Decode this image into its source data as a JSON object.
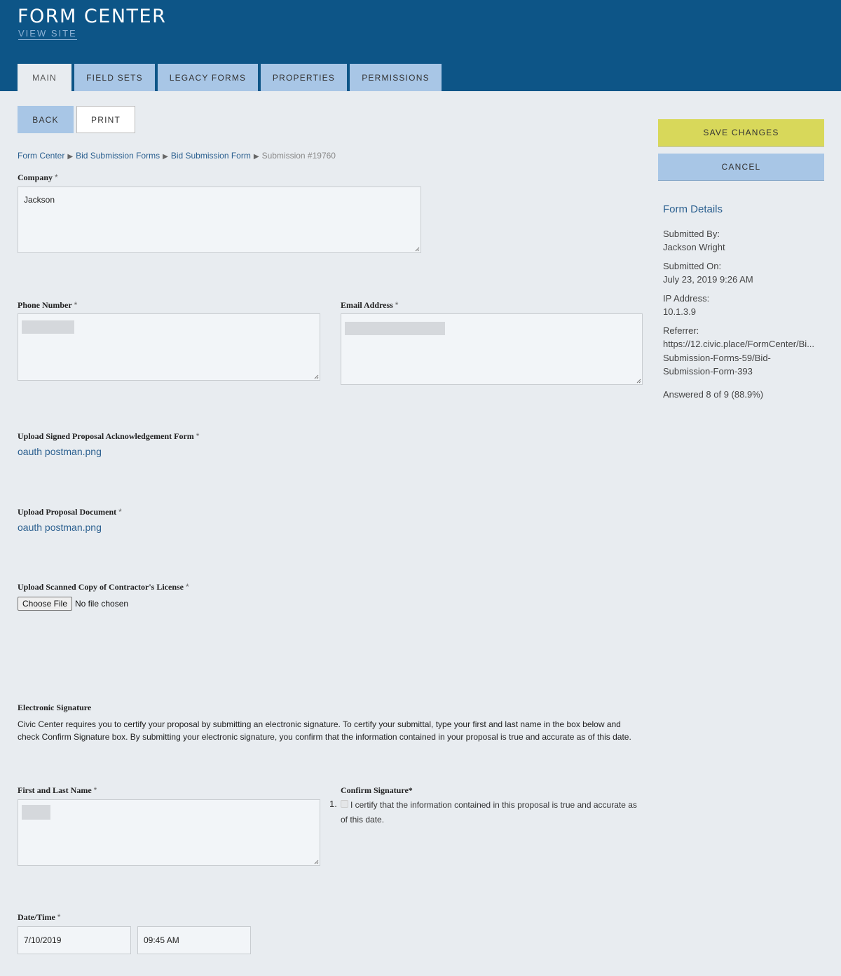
{
  "header": {
    "title": "FORM CENTER",
    "view_site": "VIEW SITE"
  },
  "tabs": [
    {
      "label": "MAIN"
    },
    {
      "label": "FIELD SETS"
    },
    {
      "label": "LEGACY FORMS"
    },
    {
      "label": "PROPERTIES"
    },
    {
      "label": "PERMISSIONS"
    }
  ],
  "toolbar": {
    "back": "BACK",
    "print": "PRINT",
    "save": "SAVE CHANGES",
    "cancel": "CANCEL"
  },
  "breadcrumb": {
    "items": [
      "Form Center",
      "Bid Submission Forms",
      "Bid Submission Form"
    ],
    "current": "Submission #19760",
    "separator": "▶"
  },
  "form": {
    "required_mark": "*",
    "company": {
      "label": "Company",
      "value": "Jackson"
    },
    "phone": {
      "label": "Phone Number"
    },
    "email": {
      "label": "Email Address"
    },
    "upload_ack": {
      "label": "Upload Signed Proposal Acknowledgement Form",
      "file": "oauth postman.png"
    },
    "upload_proposal": {
      "label": "Upload Proposal Document",
      "file": "oauth postman.png"
    },
    "upload_license": {
      "label": "Upload Scanned Copy of Contractor's License",
      "button": "Choose File",
      "status": "No file chosen"
    },
    "signature": {
      "heading": "Electronic Signature",
      "text": "Civic Center requires you to certify your proposal by submitting an electronic signature. To certify your submittal, type your first and last name in the box below and check Confirm Signature box. By submitting your electronic signature, you confirm that the information contained in your proposal is true and accurate as of this date."
    },
    "name": {
      "label": "First and Last Name"
    },
    "confirm": {
      "label": "Confirm Signature*",
      "number": "1.",
      "text": "I certify that the information contained in this proposal is true and accurate as of this date."
    },
    "datetime": {
      "label": "Date/Time",
      "date": "7/10/2019",
      "time": "09:45 AM"
    }
  },
  "details": {
    "title": "Form Details",
    "submitted_by_label": "Submitted By:",
    "submitted_by": "Jackson Wright",
    "submitted_on_label": "Submitted On:",
    "submitted_on": "July 23, 2019 9:26 AM",
    "ip_label": "IP Address:",
    "ip": "10.1.3.9",
    "referrer_label": "Referrer:",
    "referrer_1": "https://12.civic.place/FormCenter/Bi...",
    "referrer_2": "Submission-Forms-59/Bid-",
    "referrer_3": "Submission-Form-393",
    "answered": "Answered 8 of 9 (88.9%)"
  },
  "colors": {
    "header": "#0d5587",
    "tab": "#a8c6e6",
    "save": "#d8d85a",
    "link": "#2a5f8f",
    "background": "#e8ecf0"
  }
}
